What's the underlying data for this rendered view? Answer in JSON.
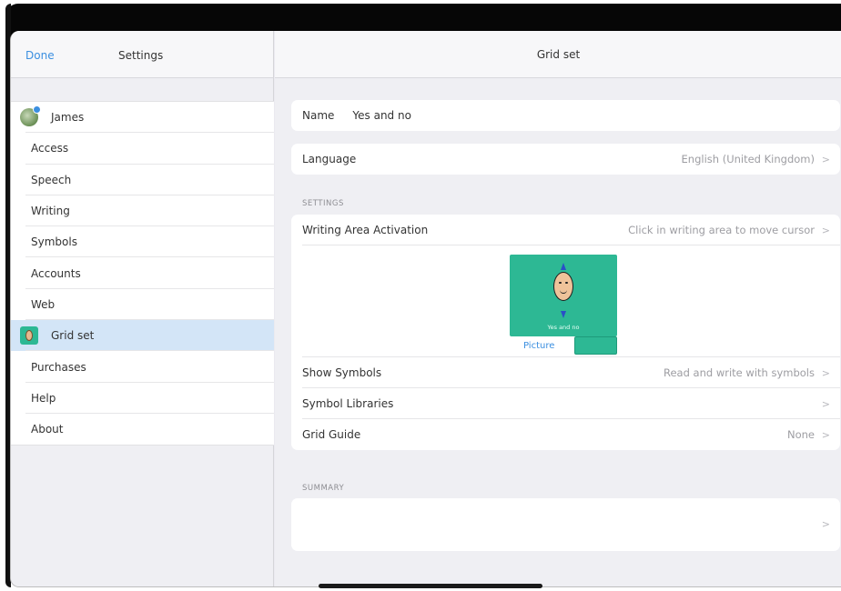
{
  "left": {
    "done_label": "Done",
    "title": "Settings",
    "items": [
      {
        "label": "James"
      },
      {
        "label": "Access"
      },
      {
        "label": "Speech"
      },
      {
        "label": "Writing"
      },
      {
        "label": "Symbols"
      },
      {
        "label": "Accounts"
      },
      {
        "label": "Web"
      },
      {
        "label": "Grid set"
      },
      {
        "label": "Purchases"
      },
      {
        "label": "Help"
      },
      {
        "label": "About"
      }
    ]
  },
  "right": {
    "title": "Grid set",
    "name_label": "Name",
    "name_value": "Yes and no",
    "language_label": "Language",
    "language_value": "English (United Kingdom)",
    "settings_section": "SETTINGS",
    "writing_area_label": "Writing Area Activation",
    "writing_area_value": "Click in writing area to move cursor",
    "preview_caption": "Yes and no",
    "picture_label": "Picture",
    "show_symbols_label": "Show Symbols",
    "show_symbols_value": "Read and write with symbols",
    "symbol_libraries_label": "Symbol Libraries",
    "grid_guide_label": "Grid Guide",
    "grid_guide_value": "None",
    "summary_section": "SUMMARY",
    "chevron": ">"
  },
  "colors": {
    "accent": "#3b8fe0",
    "tile": "#2db894",
    "selected_row": "#d3e5f7"
  },
  "icons": {
    "avatar": "user-avatar-icon",
    "grid_set": "grid-set-icon",
    "chevron": "chevron-right-icon"
  }
}
